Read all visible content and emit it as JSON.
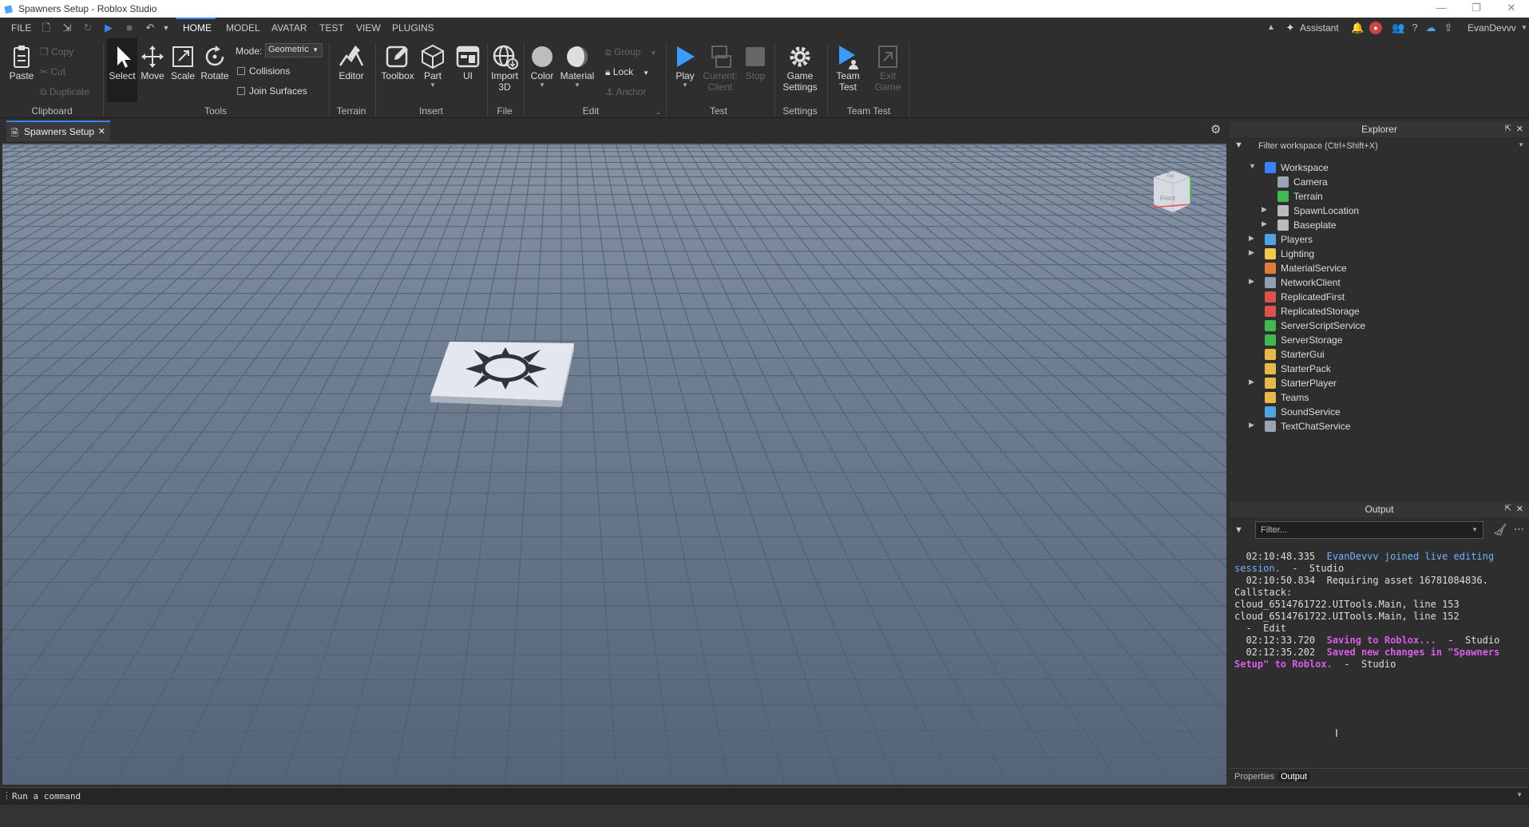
{
  "window": {
    "title": "Spawners Setup - Roblox Studio",
    "minimize": "—",
    "restore": "❐",
    "close": "✕"
  },
  "menu": {
    "tabs": [
      "FILE",
      "HOME",
      "MODEL",
      "AVATAR",
      "TEST",
      "VIEW",
      "PLUGINS"
    ],
    "active_tab": "HOME",
    "assistant": "Assistant",
    "username": "EvanDevvv"
  },
  "ribbon": {
    "clipboard": {
      "paste": "Paste",
      "copy": "Copy",
      "cut": "Cut",
      "duplicate": "Duplicate",
      "group_label": "Clipboard"
    },
    "tools": {
      "select": "Select",
      "move": "Move",
      "scale": "Scale",
      "rotate": "Rotate",
      "mode_label": "Mode:",
      "mode_value": "Geometric",
      "collisions": "Collisions",
      "join_surfaces": "Join Surfaces",
      "group_label": "Tools"
    },
    "terrain": {
      "editor": "Editor",
      "group_label": "Terrain"
    },
    "insert": {
      "toolbox": "Toolbox",
      "part": "Part",
      "ui": "UI",
      "group_label": "Insert"
    },
    "file": {
      "import_3d_line1": "Import",
      "import_3d_line2": "3D",
      "group_label": "File"
    },
    "edit": {
      "color": "Color",
      "material": "Material",
      "group": "Group",
      "lock": "Lock",
      "anchor": "Anchor",
      "group_label": "Edit"
    },
    "test": {
      "play": "Play",
      "current_line1": "Current:",
      "current_line2": "Client",
      "stop": "Stop",
      "group_label": "Test"
    },
    "settings": {
      "game_line1": "Game",
      "game_line2": "Settings",
      "group_label": "Settings"
    },
    "team_test": {
      "team_line1": "Team",
      "team_line2": "Test",
      "exit_line1": "Exit",
      "exit_line2": "Game",
      "group_label": "Team Test"
    }
  },
  "document_tab": {
    "label": "Spawners Setup",
    "close": "✕"
  },
  "viewcube": {
    "top": "Top",
    "front": "Front"
  },
  "explorer": {
    "title": "Explorer",
    "filter_placeholder": "Filter workspace (Ctrl+Shift+X)",
    "items": [
      {
        "label": "Workspace",
        "color": "#3b82f6",
        "expanded": true
      },
      {
        "label": "Camera",
        "color": "#9aa5b1"
      },
      {
        "label": "Terrain",
        "color": "#3fb950"
      },
      {
        "label": "SpawnLocation",
        "color": "#bbbbbb",
        "collapsed": true
      },
      {
        "label": "Baseplate",
        "color": "#bbbbbb",
        "collapsed": true
      },
      {
        "label": "Players",
        "color": "#4fa3e0",
        "collapsed": true
      },
      {
        "label": "Lighting",
        "color": "#f2c94c",
        "collapsed": true
      },
      {
        "label": "MaterialService",
        "color": "#e07b39"
      },
      {
        "label": "NetworkClient",
        "color": "#8fa0b5",
        "collapsed": true
      },
      {
        "label": "ReplicatedFirst",
        "color": "#d9534f"
      },
      {
        "label": "ReplicatedStorage",
        "color": "#d9534f"
      },
      {
        "label": "ServerScriptService",
        "color": "#3fb950"
      },
      {
        "label": "ServerStorage",
        "color": "#3fb950"
      },
      {
        "label": "StarterGui",
        "color": "#e8b84a"
      },
      {
        "label": "StarterPack",
        "color": "#e8b84a"
      },
      {
        "label": "StarterPlayer",
        "color": "#e8b84a",
        "collapsed": true
      },
      {
        "label": "Teams",
        "color": "#e8b84a"
      },
      {
        "label": "SoundService",
        "color": "#4fa3e0"
      },
      {
        "label": "TextChatService",
        "color": "#9aa5b1",
        "collapsed": true
      }
    ]
  },
  "output": {
    "title": "Output",
    "filter_placeholder": "Filter...",
    "lines": [
      {
        "t": "  02:10:48.335  ",
        "m": "EvanDevvv joined live editing",
        "cls": "blue"
      },
      {
        "t": "session.",
        "m": "  -  Studio",
        "cls": "plain",
        "blue_first": true
      },
      {
        "t": "  02:10:50.834  ",
        "m": "Requiring asset 16781084836.",
        "cls": "plain"
      },
      {
        "t": "Callstack:",
        "m": "",
        "cls": "plain"
      },
      {
        "t": "cloud_6514761722.UITools.Main, line 153",
        "m": "",
        "cls": "plain"
      },
      {
        "t": "cloud_6514761722.UITools.Main, line 152",
        "m": "",
        "cls": "plain"
      },
      {
        "t": "  -  Edit",
        "m": "",
        "cls": "plain"
      },
      {
        "t": "  02:12:33.720  ",
        "m": "Saving to Roblox...",
        "cls": "mag",
        "suffix": "  -  Studio"
      },
      {
        "t": "  02:12:35.202  ",
        "m": "Saved new changes in \"Spawners",
        "cls": "mag"
      },
      {
        "t": "",
        "m": "Setup\" to Roblox.",
        "cls": "mag",
        "suffix": "  -  Studio"
      }
    ]
  },
  "bottom_tabs": [
    "Properties",
    "Output"
  ],
  "command_bar": {
    "placeholder": "Run a command"
  },
  "colors": {
    "accent": "#3b82f6",
    "background": "#2e2e2e",
    "viewport": "#6e7c8f"
  }
}
